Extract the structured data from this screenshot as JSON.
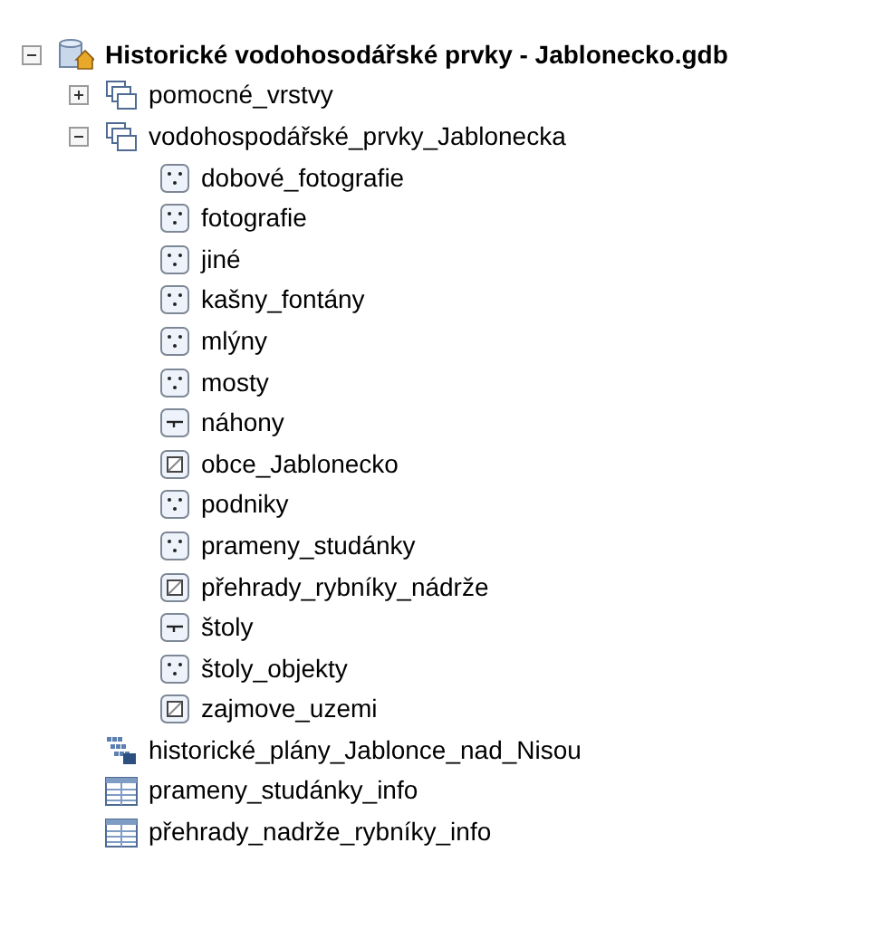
{
  "tree": [
    {
      "label": "Historické vodohosodářské prvky - Jablonecko.gdb",
      "kind": "gdb",
      "expanded": true,
      "children": [
        {
          "label": "pomocné_vrstvy",
          "kind": "dataset",
          "expanded": false
        },
        {
          "label": "vodohospodářské_prvky_Jablonecka",
          "kind": "dataset",
          "expanded": true,
          "children": [
            {
              "label": "dobové_fotografie",
              "kind": "point"
            },
            {
              "label": "fotografie",
              "kind": "point"
            },
            {
              "label": "jiné",
              "kind": "point"
            },
            {
              "label": "kašny_fontány",
              "kind": "point"
            },
            {
              "label": "mlýny",
              "kind": "point"
            },
            {
              "label": "mosty",
              "kind": "point"
            },
            {
              "label": "náhony",
              "kind": "line"
            },
            {
              "label": "obce_Jablonecko",
              "kind": "polygon"
            },
            {
              "label": "podniky",
              "kind": "point"
            },
            {
              "label": "prameny_studánky",
              "kind": "point"
            },
            {
              "label": "přehrady_rybníky_nádrže",
              "kind": "polygon"
            },
            {
              "label": "štoly",
              "kind": "line"
            },
            {
              "label": "štoly_objekty",
              "kind": "point"
            },
            {
              "label": "zajmove_uzemi",
              "kind": "polygon"
            }
          ]
        },
        {
          "label": "historické_plány_Jablonce_nad_Nisou",
          "kind": "raster"
        },
        {
          "label": "prameny_studánky_info",
          "kind": "table"
        },
        {
          "label": "přehrady_nadrže_rybníky_info",
          "kind": "table"
        }
      ]
    }
  ]
}
